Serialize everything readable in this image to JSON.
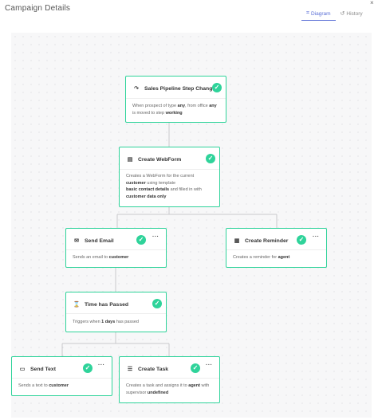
{
  "header": {
    "title": "Campaign Details",
    "close_icon": "×",
    "tabs": [
      {
        "label": "Diagram",
        "icon": "diagram-icon",
        "active": true
      },
      {
        "label": "History",
        "icon": "history-icon",
        "active": false
      }
    ]
  },
  "colors": {
    "accent": "#2fd39a",
    "tab_active": "#5a6fd6",
    "connector": "#c8c8cc"
  },
  "nodes": {
    "trigger": {
      "title": "Sales Pipeline Step Changed",
      "icon": "redirect-arrow-icon",
      "desc": {
        "p1": "When prospect of type ",
        "b1": "any",
        "p2": ", from office ",
        "b2": "any",
        "p3": " is moved to step ",
        "b3": "working"
      }
    },
    "webform": {
      "title": "Create WebForm",
      "icon": "form-icon",
      "desc": {
        "p1": "Creates a WebForm for the current",
        "b1": "customer",
        "p2": " using template",
        "b2": "basic contact details",
        "p3": " and filled in with",
        "b3": "customer data only"
      }
    },
    "send_email": {
      "title": "Send Email",
      "icon": "envelope-icon",
      "desc": {
        "p1": "Sends an email to ",
        "b1": "customer"
      }
    },
    "create_reminder": {
      "title": "Create Reminder",
      "icon": "calendar-icon",
      "desc": {
        "p1": "Creates a reminder for ",
        "b1": "agent"
      }
    },
    "time_passed": {
      "title": "Time has Passed",
      "icon": "hourglass-icon",
      "desc": {
        "p1": "Triggers when ",
        "b1": "1 days",
        "p2": " has passed"
      }
    },
    "send_text": {
      "title": "Send Text",
      "icon": "chat-icon",
      "desc": {
        "p1": "Sends a text to ",
        "b1": "customer"
      }
    },
    "create_task": {
      "title": "Create Task",
      "icon": "list-icon",
      "desc": {
        "p1": "Creates a task and assigns it to ",
        "b1": "agent",
        "p2": " with supervisor ",
        "b2": "undefined"
      }
    }
  }
}
